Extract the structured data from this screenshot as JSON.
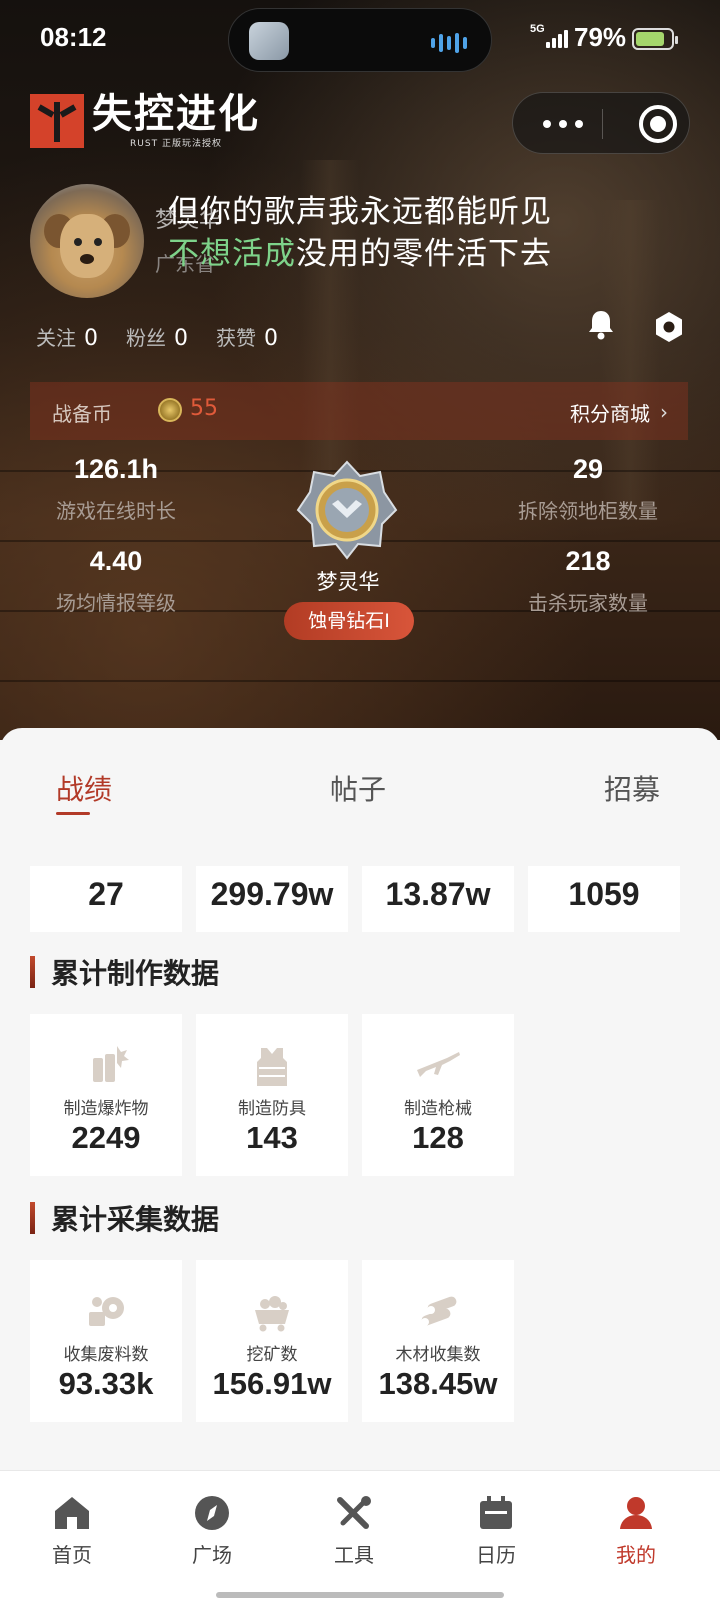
{
  "status_bar": {
    "time": "08:12",
    "network": "5G",
    "battery_pct": "79%"
  },
  "app": {
    "logo_title": "失控进化",
    "logo_subtitle": "RUST 正版玩法授权"
  },
  "profile": {
    "name": "梦灵华",
    "province": "广东省",
    "lyric_line1": "但你的歌声我永远都能听见",
    "lyric_line2_highlight": "不想活成",
    "lyric_line2_rest": "没用的零件活下去",
    "follow_label": "关注",
    "follow_count": "0",
    "fans_label": "粉丝",
    "fans_count": "0",
    "likes_label": "获赞",
    "likes_count": "0"
  },
  "coins": {
    "label": "战备币",
    "value": "55",
    "shop_label": "积分商城",
    "arrow": "›"
  },
  "stats": {
    "online_hours": {
      "value": "126.1h",
      "label": "游戏在线时长"
    },
    "cabinets": {
      "value": "29",
      "label": "拆除领地柜数量"
    },
    "intel_level": {
      "value": "4.40",
      "label": "场均情报等级"
    },
    "kills": {
      "value": "218",
      "label": "击杀玩家数量"
    }
  },
  "rank": {
    "name": "梦灵华",
    "tier": "蚀骨钻石I"
  },
  "tabs": [
    "战绩",
    "帖子",
    "招募"
  ],
  "top_values": [
    "27",
    "299.79w",
    "13.87w",
    "1059"
  ],
  "craft_section": {
    "title": "累计制作数据",
    "items": [
      {
        "label": "制造爆炸物",
        "value": "2249",
        "icon": "explosive-icon"
      },
      {
        "label": "制造防具",
        "value": "143",
        "icon": "armor-vest-icon"
      },
      {
        "label": "制造枪械",
        "value": "128",
        "icon": "rifle-icon"
      }
    ]
  },
  "gather_section": {
    "title": "累计采集数据",
    "items": [
      {
        "label": "收集废料数",
        "value": "93.33k",
        "icon": "scrap-gears-icon"
      },
      {
        "label": "挖矿数",
        "value": "156.91w",
        "icon": "mine-cart-icon"
      },
      {
        "label": "木材收集数",
        "value": "138.45w",
        "icon": "wood-logs-icon"
      }
    ]
  },
  "nav": [
    {
      "label": "首页",
      "icon": "home-icon"
    },
    {
      "label": "广场",
      "icon": "compass-icon"
    },
    {
      "label": "工具",
      "icon": "tools-icon"
    },
    {
      "label": "日历",
      "icon": "calendar-icon"
    },
    {
      "label": "我的",
      "icon": "user-icon",
      "active": true
    }
  ],
  "colors": {
    "accent": "#b23a28",
    "lyric_highlight": "#7ed38a",
    "coin_value": "#e05a3a"
  }
}
